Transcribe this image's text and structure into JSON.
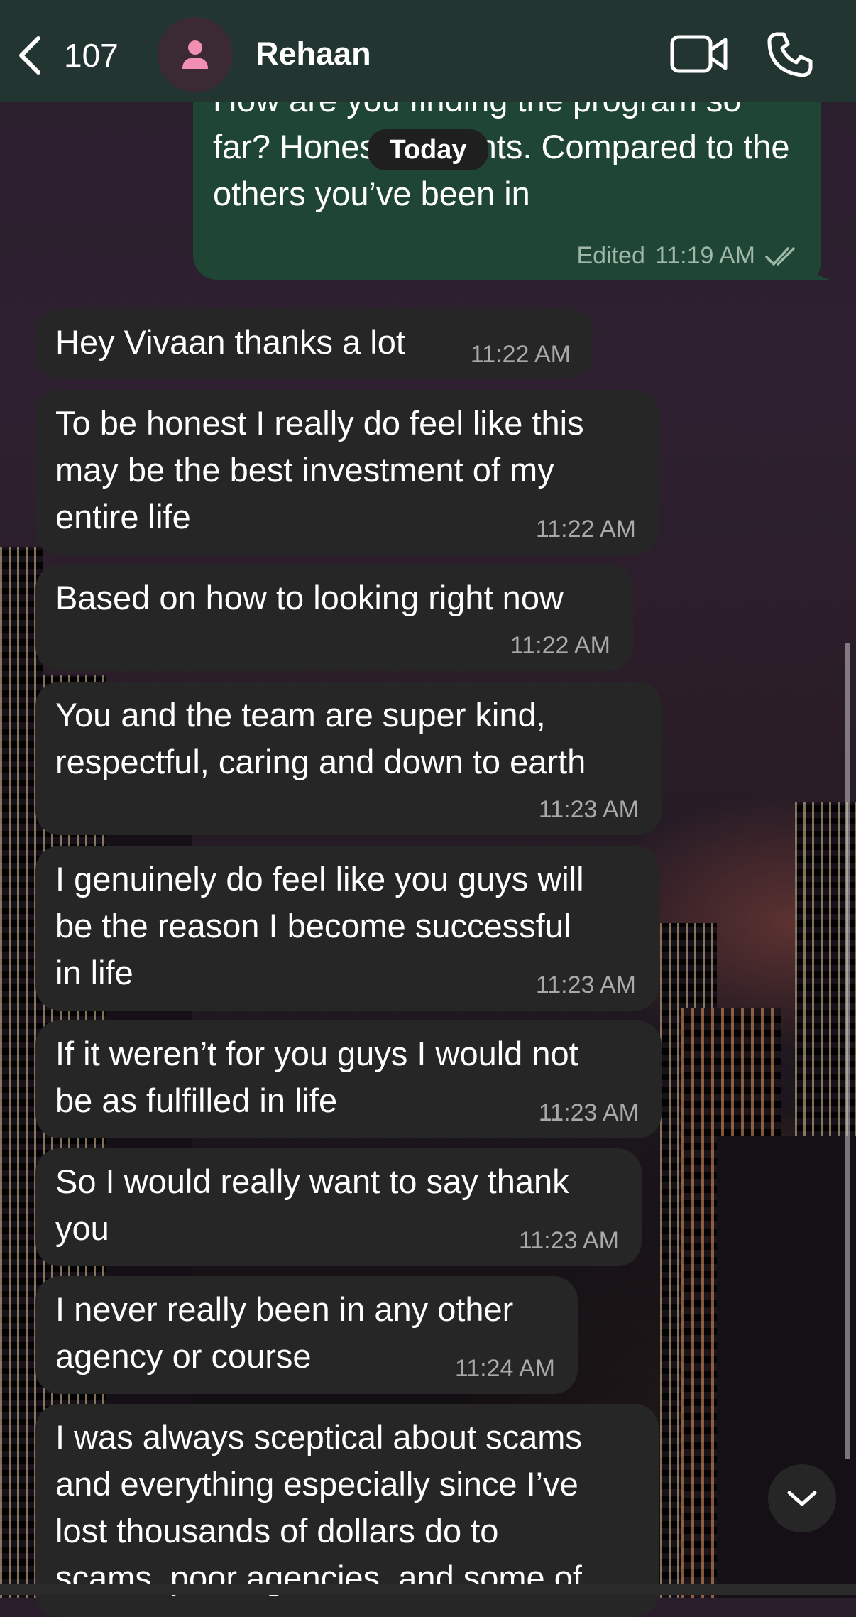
{
  "header": {
    "back_count": "107",
    "contact_name": "Rehaan"
  },
  "date_separator": "Today",
  "outgoing": {
    "text": "How are you finding the program so far? Honest thoughts. Compared to the others you’ve been in",
    "edited_label": "Edited",
    "time": "11:19 AM",
    "status": "read"
  },
  "messages": [
    {
      "text": "Hey Vivaan thanks a lot",
      "time": "11:22 AM"
    },
    {
      "text": "To be honest I really do feel like this\nmay be the best investment of my\nentire life",
      "time": "11:22 AM"
    },
    {
      "text": "Based on how to looking right now",
      "time": "11:22 AM"
    },
    {
      "text": "You and the team are super kind,\nrespectful, caring and down to earth",
      "time": "11:23 AM"
    },
    {
      "text": "I genuinely do feel like you guys will\nbe the reason I become successful\nin life",
      "time": "11:23 AM"
    },
    {
      "text": "If it weren’t for you guys I would not\nbe as fulfilled in life",
      "time": "11:23 AM"
    },
    {
      "text": "So I would really want to say thank\nyou",
      "time": "11:23 AM"
    },
    {
      "text": "I never really been in any other\nagency or course",
      "time": "11:24 AM"
    },
    {
      "text": "I was always sceptical about scams\nand everything especially since I’ve\nlost thousands of dollars do to\nscams, poor agencies, and some of",
      "time": ""
    }
  ],
  "colors": {
    "header_bg": "#233530",
    "incoming_bubble": "#262626",
    "outgoing_bubble": "#1f4535",
    "avatar_accent": "#f08fb0"
  },
  "icons": [
    "chevron-left-icon",
    "person-icon",
    "video-camera-icon",
    "phone-icon",
    "double-check-icon",
    "chevron-down-icon"
  ]
}
